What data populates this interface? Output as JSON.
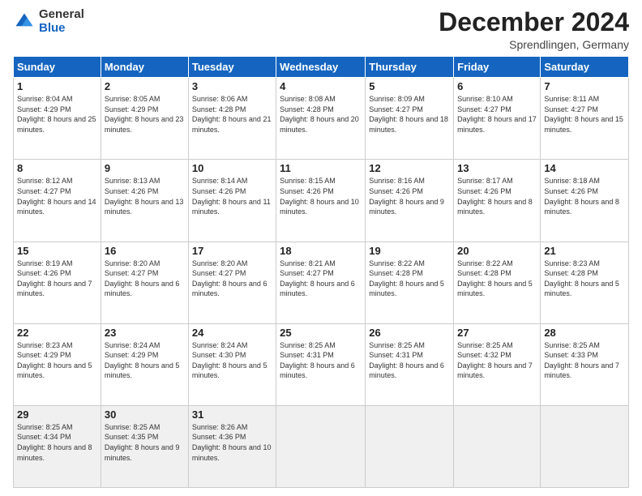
{
  "header": {
    "logo": {
      "general": "General",
      "blue": "Blue"
    },
    "month": "December 2024",
    "location": "Sprendlingen, Germany"
  },
  "weekdays": [
    "Sunday",
    "Monday",
    "Tuesday",
    "Wednesday",
    "Thursday",
    "Friday",
    "Saturday"
  ],
  "weeks": [
    [
      {
        "day": "1",
        "sunrise": "8:04 AM",
        "sunset": "4:29 PM",
        "daylight": "8 hours and 25 minutes."
      },
      {
        "day": "2",
        "sunrise": "8:05 AM",
        "sunset": "4:29 PM",
        "daylight": "8 hours and 23 minutes."
      },
      {
        "day": "3",
        "sunrise": "8:06 AM",
        "sunset": "4:28 PM",
        "daylight": "8 hours and 21 minutes."
      },
      {
        "day": "4",
        "sunrise": "8:08 AM",
        "sunset": "4:28 PM",
        "daylight": "8 hours and 20 minutes."
      },
      {
        "day": "5",
        "sunrise": "8:09 AM",
        "sunset": "4:27 PM",
        "daylight": "8 hours and 18 minutes."
      },
      {
        "day": "6",
        "sunrise": "8:10 AM",
        "sunset": "4:27 PM",
        "daylight": "8 hours and 17 minutes."
      },
      {
        "day": "7",
        "sunrise": "8:11 AM",
        "sunset": "4:27 PM",
        "daylight": "8 hours and 15 minutes."
      }
    ],
    [
      {
        "day": "8",
        "sunrise": "8:12 AM",
        "sunset": "4:27 PM",
        "daylight": "8 hours and 14 minutes."
      },
      {
        "day": "9",
        "sunrise": "8:13 AM",
        "sunset": "4:26 PM",
        "daylight": "8 hours and 13 minutes."
      },
      {
        "day": "10",
        "sunrise": "8:14 AM",
        "sunset": "4:26 PM",
        "daylight": "8 hours and 11 minutes."
      },
      {
        "day": "11",
        "sunrise": "8:15 AM",
        "sunset": "4:26 PM",
        "daylight": "8 hours and 10 minutes."
      },
      {
        "day": "12",
        "sunrise": "8:16 AM",
        "sunset": "4:26 PM",
        "daylight": "8 hours and 9 minutes."
      },
      {
        "day": "13",
        "sunrise": "8:17 AM",
        "sunset": "4:26 PM",
        "daylight": "8 hours and 8 minutes."
      },
      {
        "day": "14",
        "sunrise": "8:18 AM",
        "sunset": "4:26 PM",
        "daylight": "8 hours and 8 minutes."
      }
    ],
    [
      {
        "day": "15",
        "sunrise": "8:19 AM",
        "sunset": "4:26 PM",
        "daylight": "8 hours and 7 minutes."
      },
      {
        "day": "16",
        "sunrise": "8:20 AM",
        "sunset": "4:27 PM",
        "daylight": "8 hours and 6 minutes."
      },
      {
        "day": "17",
        "sunrise": "8:20 AM",
        "sunset": "4:27 PM",
        "daylight": "8 hours and 6 minutes."
      },
      {
        "day": "18",
        "sunrise": "8:21 AM",
        "sunset": "4:27 PM",
        "daylight": "8 hours and 6 minutes."
      },
      {
        "day": "19",
        "sunrise": "8:22 AM",
        "sunset": "4:28 PM",
        "daylight": "8 hours and 5 minutes."
      },
      {
        "day": "20",
        "sunrise": "8:22 AM",
        "sunset": "4:28 PM",
        "daylight": "8 hours and 5 minutes."
      },
      {
        "day": "21",
        "sunrise": "8:23 AM",
        "sunset": "4:28 PM",
        "daylight": "8 hours and 5 minutes."
      }
    ],
    [
      {
        "day": "22",
        "sunrise": "8:23 AM",
        "sunset": "4:29 PM",
        "daylight": "8 hours and 5 minutes."
      },
      {
        "day": "23",
        "sunrise": "8:24 AM",
        "sunset": "4:29 PM",
        "daylight": "8 hours and 5 minutes."
      },
      {
        "day": "24",
        "sunrise": "8:24 AM",
        "sunset": "4:30 PM",
        "daylight": "8 hours and 5 minutes."
      },
      {
        "day": "25",
        "sunrise": "8:25 AM",
        "sunset": "4:31 PM",
        "daylight": "8 hours and 6 minutes."
      },
      {
        "day": "26",
        "sunrise": "8:25 AM",
        "sunset": "4:31 PM",
        "daylight": "8 hours and 6 minutes."
      },
      {
        "day": "27",
        "sunrise": "8:25 AM",
        "sunset": "4:32 PM",
        "daylight": "8 hours and 7 minutes."
      },
      {
        "day": "28",
        "sunrise": "8:25 AM",
        "sunset": "4:33 PM",
        "daylight": "8 hours and 7 minutes."
      }
    ],
    [
      {
        "day": "29",
        "sunrise": "8:25 AM",
        "sunset": "4:34 PM",
        "daylight": "8 hours and 8 minutes."
      },
      {
        "day": "30",
        "sunrise": "8:25 AM",
        "sunset": "4:35 PM",
        "daylight": "8 hours and 9 minutes."
      },
      {
        "day": "31",
        "sunrise": "8:26 AM",
        "sunset": "4:36 PM",
        "daylight": "8 hours and 10 minutes."
      },
      null,
      null,
      null,
      null
    ]
  ]
}
